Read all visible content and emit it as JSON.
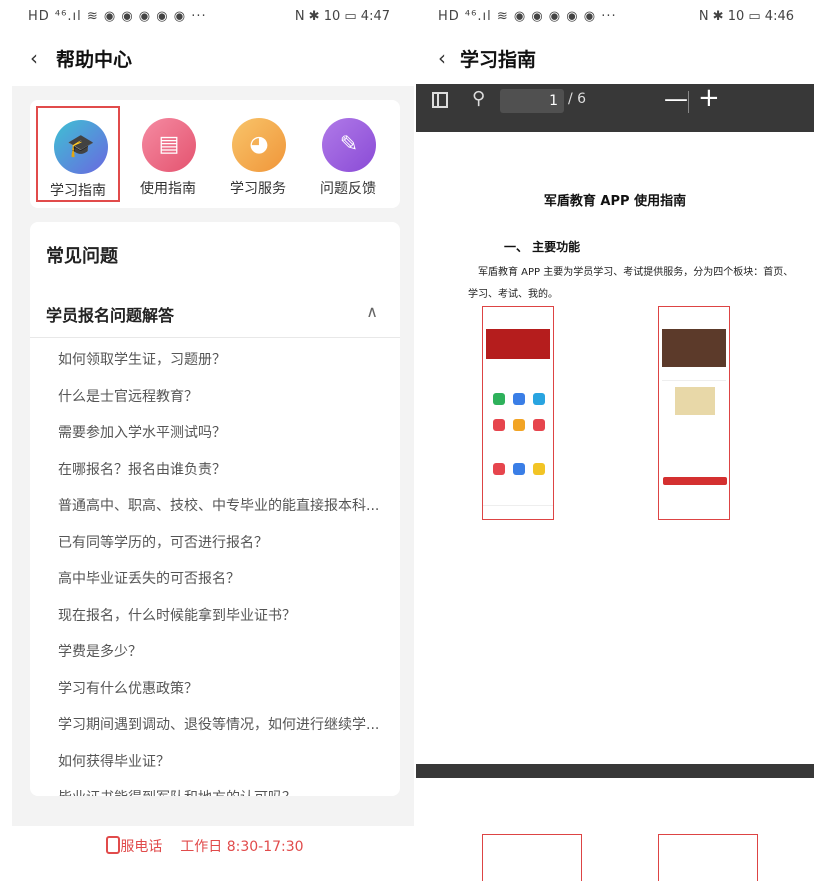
{
  "left": {
    "status": {
      "left": "HD ⁴⁶.ıl ≋ ◉ ◉ ◉ ◉ ◉ ···",
      "right": "N ✱ 10 ▭ 4:47"
    },
    "nav": {
      "back": "‹",
      "title": "帮助中心"
    },
    "quick": [
      {
        "label": "学习指南",
        "icon": "graduation-cap-icon",
        "color": "#4a90e2"
      },
      {
        "label": "使用指南",
        "icon": "book-icon",
        "color": "#ef6b8a"
      },
      {
        "label": "学习服务",
        "icon": "headset-icon",
        "color": "#f5a742"
      },
      {
        "label": "问题反馈",
        "icon": "edit-icon",
        "color": "#9b59d6"
      }
    ],
    "faq_title": "常见问题",
    "group_title": "学员报名问题解答",
    "questions": [
      "如何领取学生证，习题册？",
      "什么是士官远程教育？",
      "需要参加入学水平测试吗？",
      "在哪报名？报名由谁负责？",
      "普通高中、职高、技校、中专毕业的能直接报本科...",
      "已有同等学历的，可否进行报名？",
      "高中毕业证丢失的可否报名？",
      "现在报名，什么时候能拿到毕业证书？",
      "学费是多少？",
      "学习有什么优惠政策？",
      "学习期间遇到调动、退役等情况，如何进行继续学...",
      "如何获得毕业证？",
      "毕业证书能得到军队和地方的认可吗？"
    ],
    "footer": {
      "label": "客服电话",
      "hours": "工作日 8:30-17:30"
    }
  },
  "right": {
    "status": {
      "left": "HD ⁴⁶.ıl ≋ ◉ ◉ ◉ ◉ ◉ ···",
      "right": "N ✱ 10 ▭ 4:46"
    },
    "nav": {
      "back": "‹",
      "title": "学习指南"
    },
    "pdf": {
      "page": "1",
      "total": "/ 6",
      "minus": "—",
      "plus": "+"
    },
    "doc": {
      "title": "军盾教育 APP 使用指南",
      "section": "一、 主要功能",
      "para1": "军盾教育 APP 主要为学员学习、考试提供服务，分为四个板块：首页、",
      "para2": "学习、考试、我的。"
    }
  }
}
